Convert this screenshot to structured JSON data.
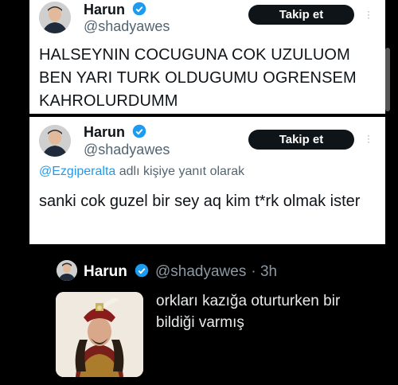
{
  "tweet1": {
    "name": "Harun",
    "handle": "@shadyawes",
    "follow_label": "Takip et",
    "text": "HALSEYNIN COCUGUNA COK UZULUOM BEN YARI TURK OLDUGUMU OGRENSEM KAHROLURDUMM"
  },
  "tweet2": {
    "name": "Harun",
    "handle": "@shadyawes",
    "follow_label": "Takip et",
    "reply_mention": "@Ezgiperalta",
    "reply_suffix": " adlı kişiye yanıt olarak",
    "text": "sanki cok guzel bir sey aq kim t*rk olmak ister"
  },
  "tweet3": {
    "name": "Harun",
    "handle": "@shadyawes",
    "time": "· 3h",
    "text": "orkları kazığa oturturken bir bildiği varmış"
  },
  "colors": {
    "accent": "#1d9bf0",
    "follow_button_bg": "#0f1419",
    "dark_bg": "#000000"
  }
}
